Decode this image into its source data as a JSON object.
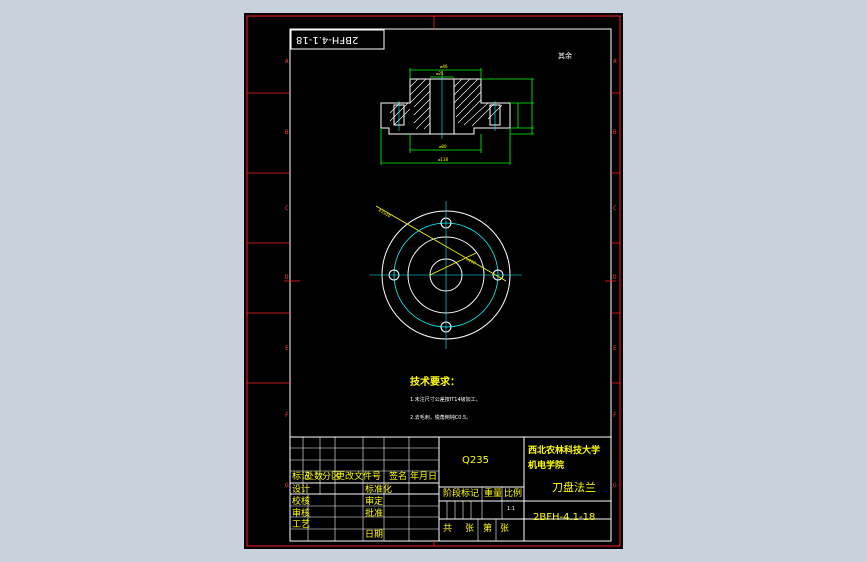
{
  "drawing_number": "2BFH-4.1-18",
  "drawing_number_rotated": "2BFH-4.1-18",
  "roughness_note": "其余",
  "tech_requirements": {
    "title": "技术要求：",
    "items": [
      "1.未注尺寸公差按IT14级加工，",
      "2.去毛刺，锐角倒钝C0.5。"
    ]
  },
  "title_block": {
    "material": "Q235",
    "school": "西北农林科技大学",
    "college": "机电学院",
    "part_name": "刀盘法兰",
    "drawing_code": "2BFH-4.1-18",
    "revision_headers": [
      "标记",
      "处数",
      "分区",
      "更改文件号",
      "签名",
      "年月日"
    ],
    "role_labels": [
      "设计",
      "校核",
      "审核",
      "工艺"
    ],
    "role_labels_right": [
      "标准化",
      "审定",
      "批准",
      "日期"
    ],
    "stage_headers": [
      "阶段标记",
      "重量",
      "比例"
    ],
    "scale": "1:1",
    "sheet_text": [
      "共",
      "张",
      "第",
      "张"
    ]
  },
  "ruler_letters_left": [
    "A",
    "B",
    "C",
    "D",
    "E",
    "F",
    "G"
  ],
  "ruler_letters_right": [
    "A",
    "B",
    "C",
    "D",
    "E",
    "F",
    "G"
  ],
  "colors": {
    "frame": "#ff2020",
    "outline": "#ffffff",
    "dimension": "#00ff00",
    "center_line": "#00ffff",
    "annotation": "#ffff00",
    "title_block": "#ffffff",
    "canvas_bg": "#000000"
  }
}
